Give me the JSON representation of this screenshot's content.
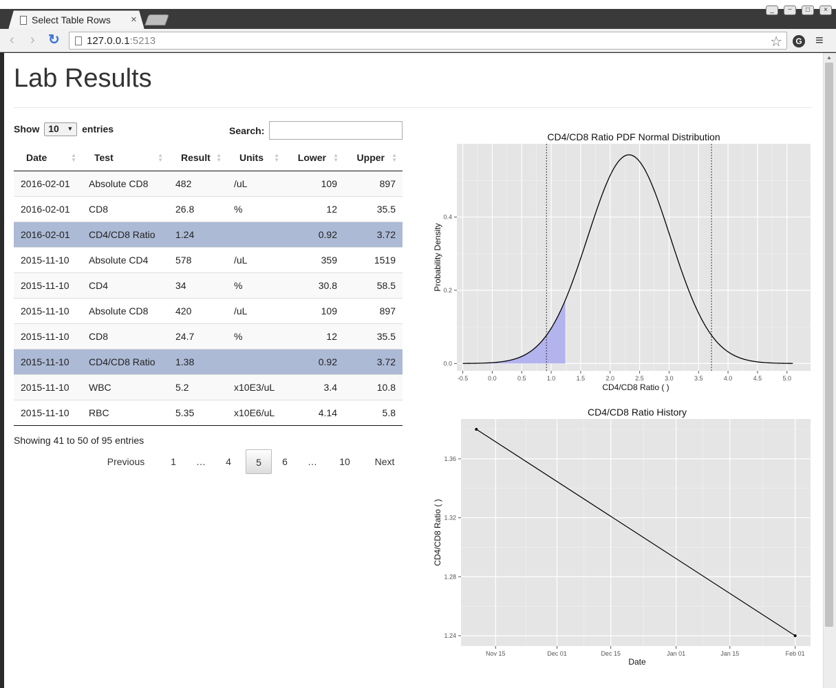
{
  "browser": {
    "tab_title": "Select Table Rows",
    "tab_close": "×",
    "url_host": "127.0.0.1",
    "url_port": ":5213",
    "back_glyph": "‹",
    "forward_glyph": "›",
    "reload_glyph": "↻",
    "star_glyph": "☆",
    "menu_glyph": "≡",
    "ext_glyph": "G"
  },
  "page": {
    "title": "Lab Results"
  },
  "table_controls": {
    "show_label": "Show",
    "entries_value": "10",
    "entries_label": "entries",
    "search_label": "Search:",
    "search_value": ""
  },
  "table": {
    "columns": [
      "Date",
      "Test",
      "Result",
      "Units",
      "Lower",
      "Upper"
    ],
    "rows": [
      {
        "date": "2016-02-01",
        "test": "Absolute CD8",
        "result": "482",
        "units": "/uL",
        "lower": "109",
        "upper": "897",
        "selected": false
      },
      {
        "date": "2016-02-01",
        "test": "CD8",
        "result": "26.8",
        "units": "%",
        "lower": "12",
        "upper": "35.5",
        "selected": false
      },
      {
        "date": "2016-02-01",
        "test": "CD4/CD8 Ratio",
        "result": "1.24",
        "units": "",
        "lower": "0.92",
        "upper": "3.72",
        "selected": true
      },
      {
        "date": "2015-11-10",
        "test": "Absolute CD4",
        "result": "578",
        "units": "/uL",
        "lower": "359",
        "upper": "1519",
        "selected": false
      },
      {
        "date": "2015-11-10",
        "test": "CD4",
        "result": "34",
        "units": "%",
        "lower": "30.8",
        "upper": "58.5",
        "selected": false
      },
      {
        "date": "2015-11-10",
        "test": "Absolute CD8",
        "result": "420",
        "units": "/uL",
        "lower": "109",
        "upper": "897",
        "selected": false
      },
      {
        "date": "2015-11-10",
        "test": "CD8",
        "result": "24.7",
        "units": "%",
        "lower": "12",
        "upper": "35.5",
        "selected": false
      },
      {
        "date": "2015-11-10",
        "test": "CD4/CD8 Ratio",
        "result": "1.38",
        "units": "",
        "lower": "0.92",
        "upper": "3.72",
        "selected": true
      },
      {
        "date": "2015-11-10",
        "test": "WBC",
        "result": "5.2",
        "units": "x10E3/uL",
        "lower": "3.4",
        "upper": "10.8",
        "selected": false
      },
      {
        "date": "2015-11-10",
        "test": "RBC",
        "result": "5.35",
        "units": "x10E6/uL",
        "lower": "4.14",
        "upper": "5.8",
        "selected": false
      }
    ],
    "info": "Showing 41 to 50 of 95 entries"
  },
  "pagination": {
    "previous": "Previous",
    "pages": [
      "1",
      "…",
      "4",
      "5",
      "6",
      "…",
      "10"
    ],
    "current": "5",
    "next": "Next"
  },
  "colors": {
    "selected_row": "#acbad5",
    "panel_bg": "#e5e5e5",
    "shaded_area": "#b3b3ee"
  },
  "chart_data": [
    {
      "type": "line",
      "title": "CD4/CD8 Ratio PDF Normal Distribution",
      "xlabel": "CD4/CD8 Ratio (  )",
      "ylabel": "Probability Density",
      "xlim": [
        -0.6,
        5.4
      ],
      "ylim": [
        -0.02,
        0.6
      ],
      "x_ticks": [
        "-0.5",
        "0.0",
        "0.5",
        "1.0",
        "1.5",
        "2.0",
        "2.5",
        "3.0",
        "3.5",
        "4.0",
        "4.5",
        "5.0"
      ],
      "y_ticks": [
        "0.0",
        "0.2",
        "0.4"
      ],
      "distribution": {
        "mean": 2.32,
        "sd": 0.7,
        "x_range": [
          -0.5,
          5.1
        ]
      },
      "reference_lines": [
        0.92,
        3.72
      ],
      "shaded_range": [
        -0.5,
        1.24
      ],
      "grid": true
    },
    {
      "type": "line",
      "title": "CD4/CD8 Ratio History",
      "xlabel": "Date",
      "ylabel": "CD4/CD8 Ratio (  )",
      "x_ticks": [
        "Nov 15",
        "Dec 01",
        "Dec 15",
        "Jan 01",
        "Jan 15",
        "Feb 01"
      ],
      "x_tick_dates": [
        "2015-11-15",
        "2015-12-01",
        "2015-12-15",
        "2016-01-01",
        "2016-01-15",
        "2016-02-01"
      ],
      "y_ticks": [
        "1.24",
        "1.28",
        "1.32",
        "1.36"
      ],
      "ylim": [
        1.233,
        1.387
      ],
      "xlim": [
        "2015-11-06",
        "2016-02-05"
      ],
      "points": [
        {
          "x": "2015-11-10",
          "y": 1.38
        },
        {
          "x": "2016-02-01",
          "y": 1.24
        }
      ],
      "grid": true
    }
  ]
}
